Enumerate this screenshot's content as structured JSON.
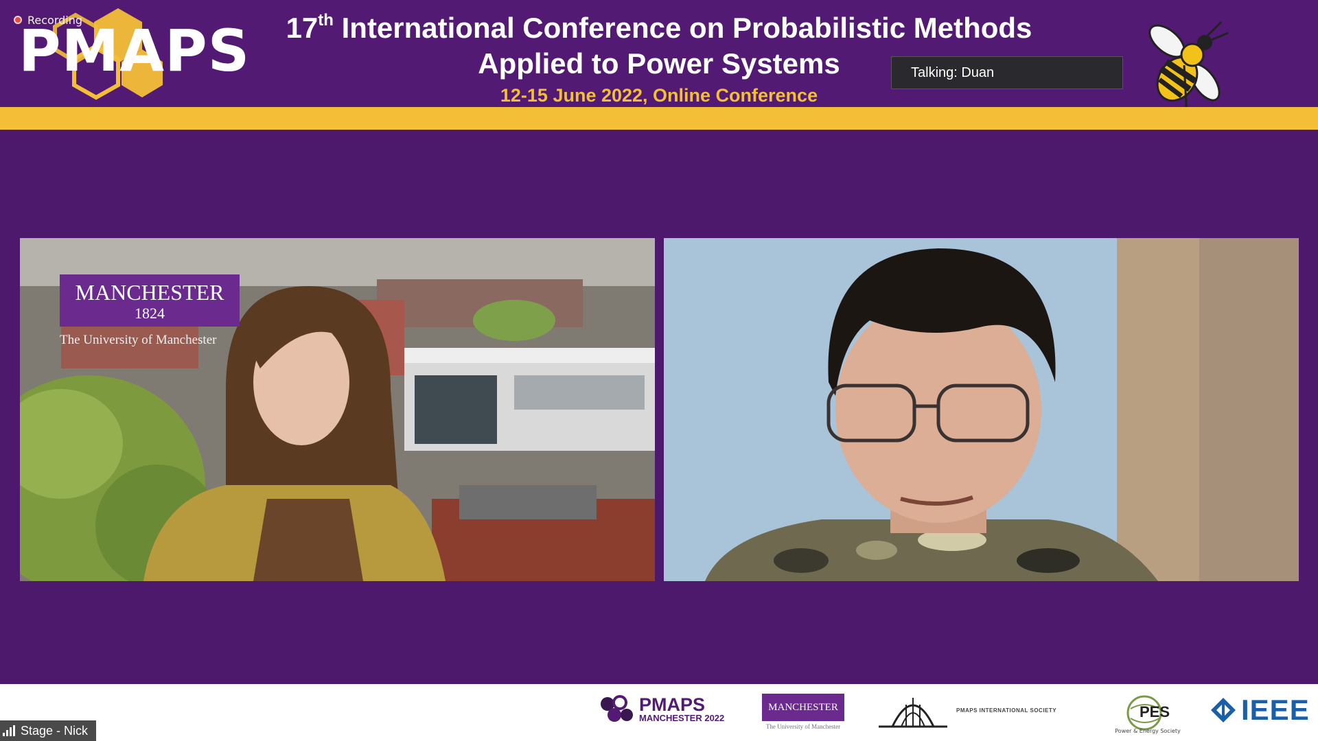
{
  "recording": {
    "label": "Recording"
  },
  "logo": {
    "text": "PMAPS"
  },
  "title": {
    "line1_prefix": "17",
    "line1_sup": "th",
    "line1_rest": " International Conference on Probabilistic Methods",
    "line2": "Applied to Power Systems",
    "line3": "12-15 June 2022, Online Conference"
  },
  "talking": {
    "label": "Talking: Duan"
  },
  "left_tile": {
    "logo_name": "MANCHESTER",
    "logo_year": "1824",
    "logo_sub": "The University of Manchester"
  },
  "footer": {
    "pmaps_name": "PMAPS",
    "pmaps_sub": "MANCHESTER 2022",
    "manchester_name": "MANCHESTER",
    "manchester_sub": "The University of Manchester",
    "intl_society": "PMAPS INTERNATIONAL SOCIETY",
    "pes": "PES",
    "pes_sub": "Power & Energy Society",
    "ieee": "IEEE"
  },
  "stage": {
    "label": "Stage - Nick"
  },
  "colors": {
    "brand_purple": "#531a73",
    "brand_gold": "#f3bf36",
    "ieee_blue": "#1a5fa8"
  },
  "icons": [
    "recording-dot-icon",
    "bee-icon",
    "signal-strength-icon",
    "ieee-diamond-icon"
  ]
}
